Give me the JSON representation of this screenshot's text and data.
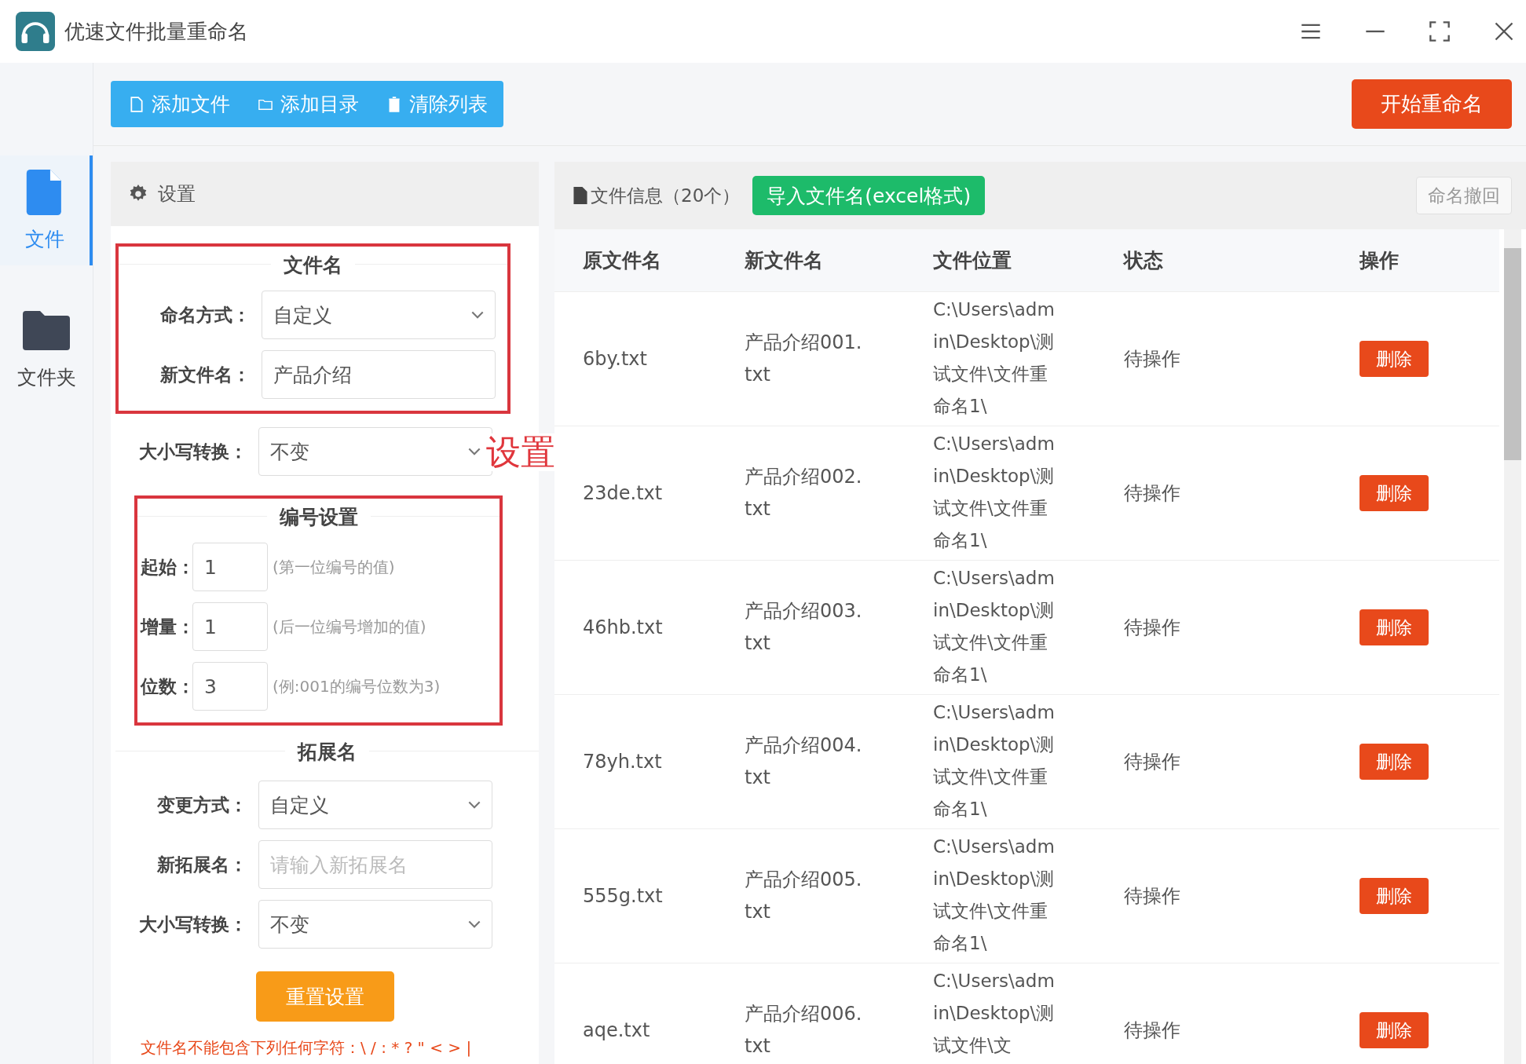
{
  "window": {
    "title": "优速文件批量重命名"
  },
  "toolbar": {
    "buttons": [
      {
        "label": "添加文件",
        "kind": "file"
      },
      {
        "label": "添加目录",
        "kind": "folder"
      },
      {
        "label": "清除列表",
        "kind": "trash"
      }
    ],
    "start_button": "开始重命名"
  },
  "nav": [
    {
      "label": "文件",
      "kind": "file",
      "selected": true
    },
    {
      "label": "文件夹",
      "kind": "folder",
      "selected": false
    }
  ],
  "settings": {
    "title": "设置",
    "annotation": "设置",
    "groups": [
      {
        "boxed": true,
        "heading": "文件名",
        "fields": [
          {
            "label": "命名方式：",
            "kind": "select",
            "value": "自定义"
          },
          {
            "label": "新文件名：",
            "kind": "input",
            "value": "产品介绍"
          }
        ]
      },
      {
        "boxed": false,
        "fields": [
          {
            "label": "大小写转换：",
            "kind": "select",
            "value": "不变"
          }
        ]
      },
      {
        "boxed": true,
        "heading": "编号设置",
        "fields": [
          {
            "label": "起始：",
            "kind": "number",
            "value": "1",
            "hint": "(第一位编号的值)"
          },
          {
            "label": "增量：",
            "kind": "number",
            "value": "1",
            "hint": "(后一位编号增加的值)"
          },
          {
            "label": "位数：",
            "kind": "number",
            "value": "3",
            "hint": "(例:001的编号位数为3)"
          }
        ]
      },
      {
        "boxed": false,
        "heading": "拓展名",
        "fields": [
          {
            "label": "变更方式：",
            "kind": "select",
            "value": "自定义"
          },
          {
            "label": "新拓展名：",
            "kind": "input",
            "placeholder": "请输入新拓展名"
          },
          {
            "label": "大小写转换：",
            "kind": "select",
            "value": "不变"
          }
        ]
      }
    ],
    "reset_button": "重置设置",
    "warning": "文件名不能包含下列任何字符：\\ / : * ? \" < > |"
  },
  "files": {
    "title": "文件信息（20个）",
    "import_button": "导入文件名(excel格式)",
    "undo_button": {
      "label": "命名撤回",
      "disabled": true
    },
    "columns": [
      "原文件名",
      "新文件名",
      "文件位置",
      "状态",
      "操作"
    ],
    "rows": [
      {
        "original": "6by.txt",
        "new": "产品介绍001.txt",
        "location": "C:\\Users\\admin\\Desktop\\测试文件\\文件重命名1\\",
        "status": "待操作",
        "action": "删除"
      },
      {
        "original": "23de.txt",
        "new": "产品介绍002.txt",
        "location": "C:\\Users\\admin\\Desktop\\测试文件\\文件重命名1\\",
        "status": "待操作",
        "action": "删除"
      },
      {
        "original": "46hb.txt",
        "new": "产品介绍003.txt",
        "location": "C:\\Users\\admin\\Desktop\\测试文件\\文件重命名1\\",
        "status": "待操作",
        "action": "删除"
      },
      {
        "original": "78yh.txt",
        "new": "产品介绍004.txt",
        "location": "C:\\Users\\admin\\Desktop\\测试文件\\文件重命名1\\",
        "status": "待操作",
        "action": "删除"
      },
      {
        "original": "555g.txt",
        "new": "产品介绍005.txt",
        "location": "C:\\Users\\admin\\Desktop\\测试文件\\文件重命名1\\",
        "status": "待操作",
        "action": "删除"
      },
      {
        "original": "aqe.txt",
        "new": "产品介绍006.txt",
        "location": "C:\\Users\\admin\\Desktop\\测试文件\\文",
        "status": "待操作",
        "action": "删除"
      }
    ]
  }
}
